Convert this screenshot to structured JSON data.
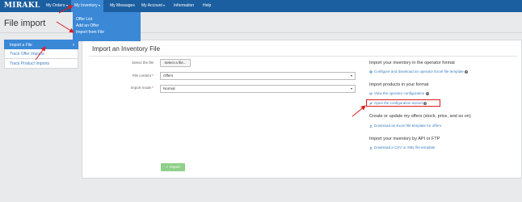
{
  "header": {
    "logo": "MIRAKL",
    "nav": [
      {
        "label": "My Orders",
        "caret": true
      },
      {
        "label": "My Inventory",
        "caret": true,
        "active": true
      },
      {
        "label": "My Messages",
        "caret": false
      },
      {
        "label": "My Account",
        "caret": true
      },
      {
        "label": "Information",
        "caret": false
      },
      {
        "label": "Help",
        "caret": false
      }
    ]
  },
  "inventory_menu": {
    "items": [
      "Offer List",
      "Add an Offer",
      "Import from File"
    ]
  },
  "page": {
    "title": "File import"
  },
  "sidebar": {
    "items": [
      {
        "label": "Import a File",
        "active": true
      },
      {
        "label": "Track Offer Imports",
        "active": false
      },
      {
        "label": "Track Product Imports",
        "active": false
      }
    ]
  },
  "panel": {
    "title": "Import an Inventory File",
    "fields": {
      "file": {
        "label": "Select the file",
        "button": "Select a file..."
      },
      "content": {
        "label": "File content",
        "required": "*",
        "value": "Offers"
      },
      "mode": {
        "label": "Import mode",
        "required": "*",
        "value": "Normal"
      }
    },
    "import_button": "Import",
    "sections": [
      {
        "heading": "Import your inventory in the operator format",
        "links": [
          {
            "text": "Configure and download an operator Excel file template",
            "icon": "gear-icon"
          }
        ]
      },
      {
        "heading": "Import products in your format",
        "links": [
          {
            "text": "View the operator configuration",
            "icon": "eye-icon"
          },
          {
            "text": "Open the configuration wizard",
            "icon": "pencil-icon"
          }
        ]
      },
      {
        "heading": "Create or update my offers (stock, price, and so on)",
        "links": [
          {
            "text": "Download an Excel file template for offers",
            "icon": "download-icon"
          }
        ]
      },
      {
        "heading": "Import your inventory by API or FTP",
        "links": [
          {
            "text": "Download a CSV or XML file template",
            "icon": "download-icon"
          }
        ]
      }
    ],
    "help_glyph": "?"
  },
  "colors": {
    "topbar": "#1b5fa0",
    "active": "#3a88d6",
    "link": "#3d7fc3",
    "annotation": "#e01b1b",
    "import_button": "#8fd08a"
  }
}
